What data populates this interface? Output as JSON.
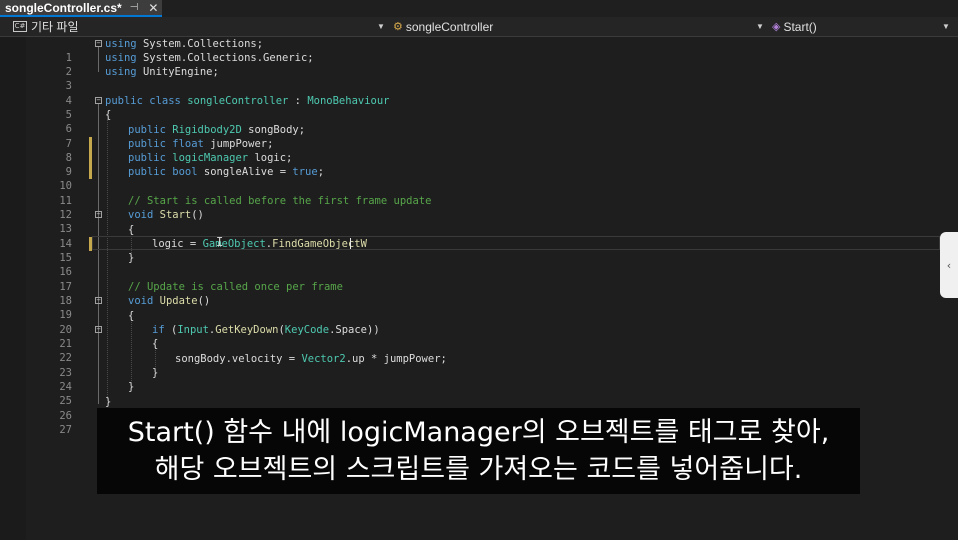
{
  "tab": {
    "title": "songleController.cs*",
    "pin_glyph": "⊣",
    "close_glyph": "✕"
  },
  "navbar": {
    "project_icon": "C#",
    "project": "기타 파일",
    "class": "songleController",
    "member": "Start()"
  },
  "code": {
    "line_numbers": [
      "1",
      "2",
      "3",
      "4",
      "5",
      "6",
      "7",
      "8",
      "9",
      "10",
      "11",
      "12",
      "13",
      "14",
      "15",
      "16",
      "17",
      "18",
      "19",
      "20",
      "21",
      "22",
      "23",
      "24",
      "25",
      "26",
      "27"
    ],
    "l1_using": "using",
    "l1_ns": "System.Collections;",
    "l2_using": "using",
    "l2_ns": "System.Collections.Generic;",
    "l3_using": "using",
    "l3_ns": "UnityEngine;",
    "l5_public": "public",
    "l5_class": "class",
    "l5_name": "songleController",
    "l5_colon": " : ",
    "l5_base": "MonoBehaviour",
    "l6": "{",
    "l7_public": "public",
    "l7_type": "Rigidbody2D",
    "l7_rest": "songBody;",
    "l8_public": "public",
    "l8_type": "float",
    "l8_rest": "jumpPower;",
    "l9_public": "public",
    "l9_type": "logicManager",
    "l9_rest": "logic;",
    "l10_public": "public",
    "l10_type": "bool",
    "l10_name": "songleAlive = ",
    "l10_val": "true",
    "l10_end": ";",
    "l12_comment": "// Start is called before the first frame update",
    "l13_void": "void",
    "l13_name": "Start",
    "l13_paren": "()",
    "l14": "{",
    "l15_a": "logic = ",
    "l15_type": "GameObject",
    "l15_dot": ".",
    "l15_fn": "FindGameObjectW",
    "l16": "}",
    "l18_comment": "// Update is called once per frame",
    "l19_void": "void",
    "l19_name": "Update",
    "l19_paren": "()",
    "l20": "{",
    "l21_if": "if",
    "l21_a": " (",
    "l21_type": "Input",
    "l21_dot": ".",
    "l21_fn": "GetKeyDown",
    "l21_b": "(",
    "l21_enum": "KeyCode",
    "l21_c": ".Space))",
    "l22": "{",
    "l23_a": "songBody.velocity = ",
    "l23_type": "Vector2",
    "l23_b": ".up * jumpPower;",
    "l24": "}",
    "l25": "}",
    "l26": "}"
  },
  "side_panel_glyph": "‹",
  "subtitle": {
    "line1": "Start() 함수 내에 logicManager의 오브젝트를 태그로 찾아,",
    "line2": "해당 오브젝트의 스크립트를 가져오는 코드를 넣어줍니다."
  },
  "colors": {
    "keyword": "#569cd6",
    "type": "#4ec9b0",
    "comment": "#57a64a",
    "method": "#dcdcaa",
    "tab_accent": "#0078d4",
    "change_marker": "#c6a84d"
  }
}
